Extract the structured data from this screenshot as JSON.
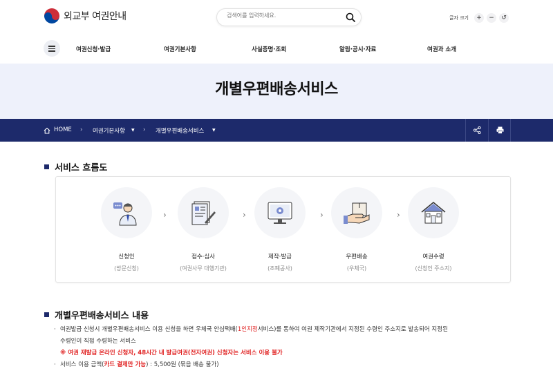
{
  "header": {
    "logo_text": "외교부 여권안내",
    "search_placeholder": "검색어를 입력하세요.",
    "font_size_label": "글자 크기",
    "font_plus": "+",
    "font_minus": "−",
    "font_reset": "↺"
  },
  "nav": {
    "items": [
      "여권신청·발급",
      "여권기본사항",
      "사실증명·조회",
      "알림·공시·자료",
      "여권과 소개"
    ]
  },
  "page_title": "개별우편배송서비스",
  "breadcrumb": {
    "home": "HOME",
    "level1": "여권기본사항",
    "level2": "개별우편배송서비스"
  },
  "flow": {
    "title": "서비스 흐름도",
    "steps": [
      {
        "label": "신청인",
        "sub": "(방문신청)",
        "icon": "applicant-icon"
      },
      {
        "label": "접수·심사",
        "sub": "(여권사무 대행기관)",
        "icon": "document-review-icon"
      },
      {
        "label": "제작·발급",
        "sub": "(조폐공사)",
        "icon": "production-icon"
      },
      {
        "label": "우편배송",
        "sub": "(우체국)",
        "icon": "parcel-delivery-icon"
      },
      {
        "label": "여권수령",
        "sub": "(신청인 주소지)",
        "icon": "house-icon"
      }
    ]
  },
  "content": {
    "title": "개별우편배송서비스 내용",
    "p1_a": "여권발급 신청시 개별우편배송서비스 이용 신청을 하면 우체국 안심택배(",
    "p1_red": "1인지정",
    "p1_b": "서비스)를 통하여 여권 제작기관에서 지정된 수령인 주소지로 발송되어 지정된",
    "p1_c": "수령인이 직접 수령하는 서비스",
    "notice": "※ 여권 재발급 온라인 신청자, 48시간 내 발급여권(전자여권) 신청자는 서비스 이용 불가",
    "p2_a": "서비스 이용 금액(",
    "p2_red": "카드 결제만 가능",
    "p2_b": ") : 5,500원 (묶음 배송 불가)"
  },
  "colors": {
    "navy": "#1d2a6b",
    "hero_bg": "#eef1fb",
    "red": "#e02020"
  }
}
